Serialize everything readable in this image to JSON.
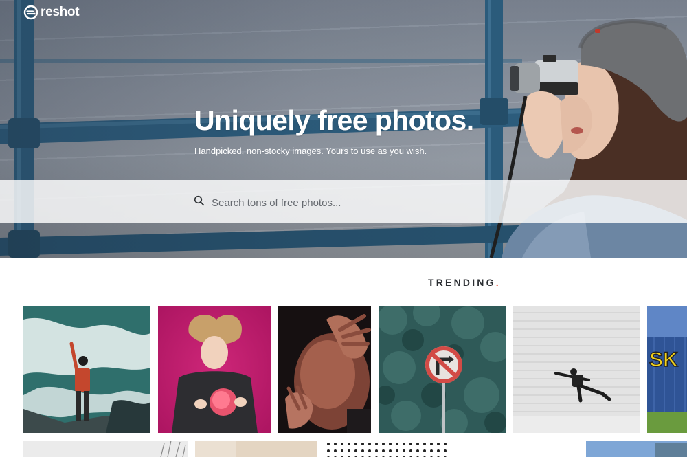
{
  "brand": {
    "name": "reshot"
  },
  "hero": {
    "title": "Uniquely free photos.",
    "subtitle_pre": "Handpicked, non-stocky images. Yours to ",
    "subtitle_link": "use as you wish",
    "subtitle_post": "."
  },
  "search": {
    "placeholder": "Search tons of free photos..."
  },
  "trending": {
    "label": "TRENDING",
    "dot": "."
  },
  "photos": [
    {
      "name": "photo-man-on-rocks-waves"
    },
    {
      "name": "photo-girl-on-pink-background"
    },
    {
      "name": "photo-man-face-hands"
    },
    {
      "name": "photo-no-right-turn-sign-trees"
    },
    {
      "name": "photo-man-jumping-white-wall"
    },
    {
      "name": "photo-blue-building-sign"
    }
  ],
  "colors": {
    "accent_dot": "#e8503a",
    "rail_blue": "#2c5c7c",
    "pink_bg": "#c1196d"
  }
}
